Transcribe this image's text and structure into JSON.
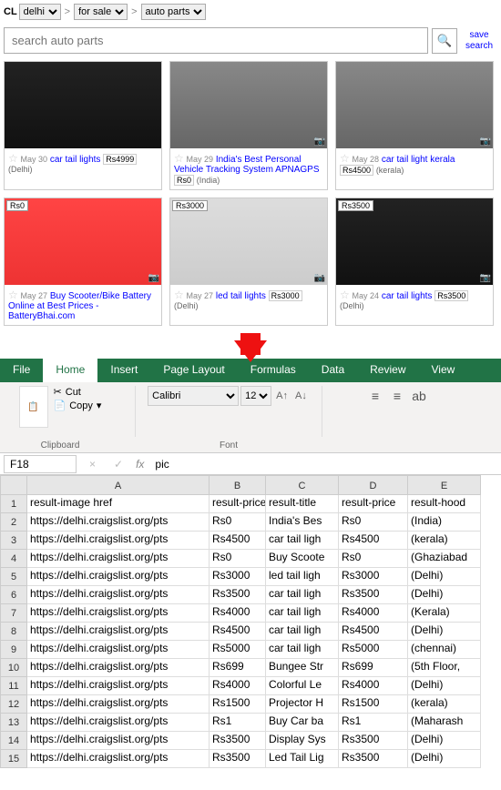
{
  "cl": {
    "label": "CL",
    "crumbs": [
      "delhi",
      "for sale",
      "auto parts"
    ],
    "search_placeholder": "search auto parts",
    "save_search": "save search"
  },
  "listings": [
    {
      "date": "May 30",
      "title": "car tail lights",
      "price": "Rs4999",
      "loc": "(Delhi)",
      "img": "dark",
      "top_price": "",
      "pic_icon": ""
    },
    {
      "date": "May 29",
      "title": "India's Best Personal Vehicle Tracking System APNAGPS",
      "price": "Rs0",
      "loc": "(India)",
      "img": "gray",
      "top_price": "",
      "pic_icon": true
    },
    {
      "date": "May 28",
      "title": "car tail light kerala",
      "price": "Rs4500",
      "loc": "(kerala)",
      "img": "gray",
      "top_price": "",
      "pic_icon": true
    },
    {
      "date": "May 27",
      "title": "Buy Scooter/Bike Battery Online at Best Prices - BatteryBhai.com",
      "price": "",
      "loc": "",
      "img": "red",
      "top_price": "Rs0",
      "pic_icon": true
    },
    {
      "date": "May 27",
      "title": "led tail lights",
      "price": "Rs3000",
      "loc": "(Delhi)",
      "img": "white",
      "top_price": "Rs3000",
      "pic_icon": true
    },
    {
      "date": "May 24",
      "title": "car tail lights",
      "price": "Rs3500",
      "loc": "(Delhi)",
      "img": "dark",
      "top_price": "Rs3500",
      "pic_icon": true
    }
  ],
  "excel": {
    "tabs": [
      "File",
      "Home",
      "Insert",
      "Page Layout",
      "Formulas",
      "Data",
      "Review",
      "View"
    ],
    "active_tab": "Home",
    "clipboard": {
      "cut": "Cut",
      "copy": "Copy",
      "label": "Clipboard"
    },
    "font": {
      "name": "Calibri",
      "size": "12",
      "label": "Font"
    },
    "name_box": "F18",
    "formula": "pic",
    "columns": [
      "A",
      "B",
      "C",
      "D",
      "E"
    ],
    "headers": [
      "result-image href",
      "result-price",
      "result-title",
      "result-price",
      "result-hood"
    ],
    "rows": [
      [
        "https://delhi.craigslist.org/pts",
        "Rs0",
        "India's Bes",
        "Rs0",
        "(India)"
      ],
      [
        "https://delhi.craigslist.org/pts",
        "Rs4500",
        "car tail ligh",
        "Rs4500",
        "(kerala)"
      ],
      [
        "https://delhi.craigslist.org/pts",
        "Rs0",
        "Buy Scoote",
        "Rs0",
        "(Ghaziabad"
      ],
      [
        "https://delhi.craigslist.org/pts",
        "Rs3000",
        "led tail ligh",
        "Rs3000",
        "(Delhi)"
      ],
      [
        "https://delhi.craigslist.org/pts",
        "Rs3500",
        "car tail ligh",
        "Rs3500",
        "(Delhi)"
      ],
      [
        "https://delhi.craigslist.org/pts",
        "Rs4000",
        "car tail ligh",
        "Rs4000",
        "(Kerala)"
      ],
      [
        "https://delhi.craigslist.org/pts",
        "Rs4500",
        "car tail ligh",
        "Rs4500",
        "(Delhi)"
      ],
      [
        "https://delhi.craigslist.org/pts",
        "Rs5000",
        "car tail ligh",
        "Rs5000",
        "(chennai)"
      ],
      [
        "https://delhi.craigslist.org/pts",
        "Rs699",
        "Bungee Str",
        "Rs699",
        "(5th Floor,"
      ],
      [
        "https://delhi.craigslist.org/pts",
        "Rs4000",
        "Colorful Le",
        "Rs4000",
        "(Delhi)"
      ],
      [
        "https://delhi.craigslist.org/pts",
        "Rs1500",
        "Projector H",
        "Rs1500",
        "(kerala)"
      ],
      [
        "https://delhi.craigslist.org/pts",
        "Rs1",
        "Buy Car ba",
        "Rs1",
        "(Maharash"
      ],
      [
        "https://delhi.craigslist.org/pts",
        "Rs3500",
        "Display Sys",
        "Rs3500",
        "(Delhi)"
      ],
      [
        "https://delhi.craigslist.org/pts",
        "Rs3500",
        "Led Tail Lig",
        "Rs3500",
        "(Delhi)"
      ]
    ]
  }
}
